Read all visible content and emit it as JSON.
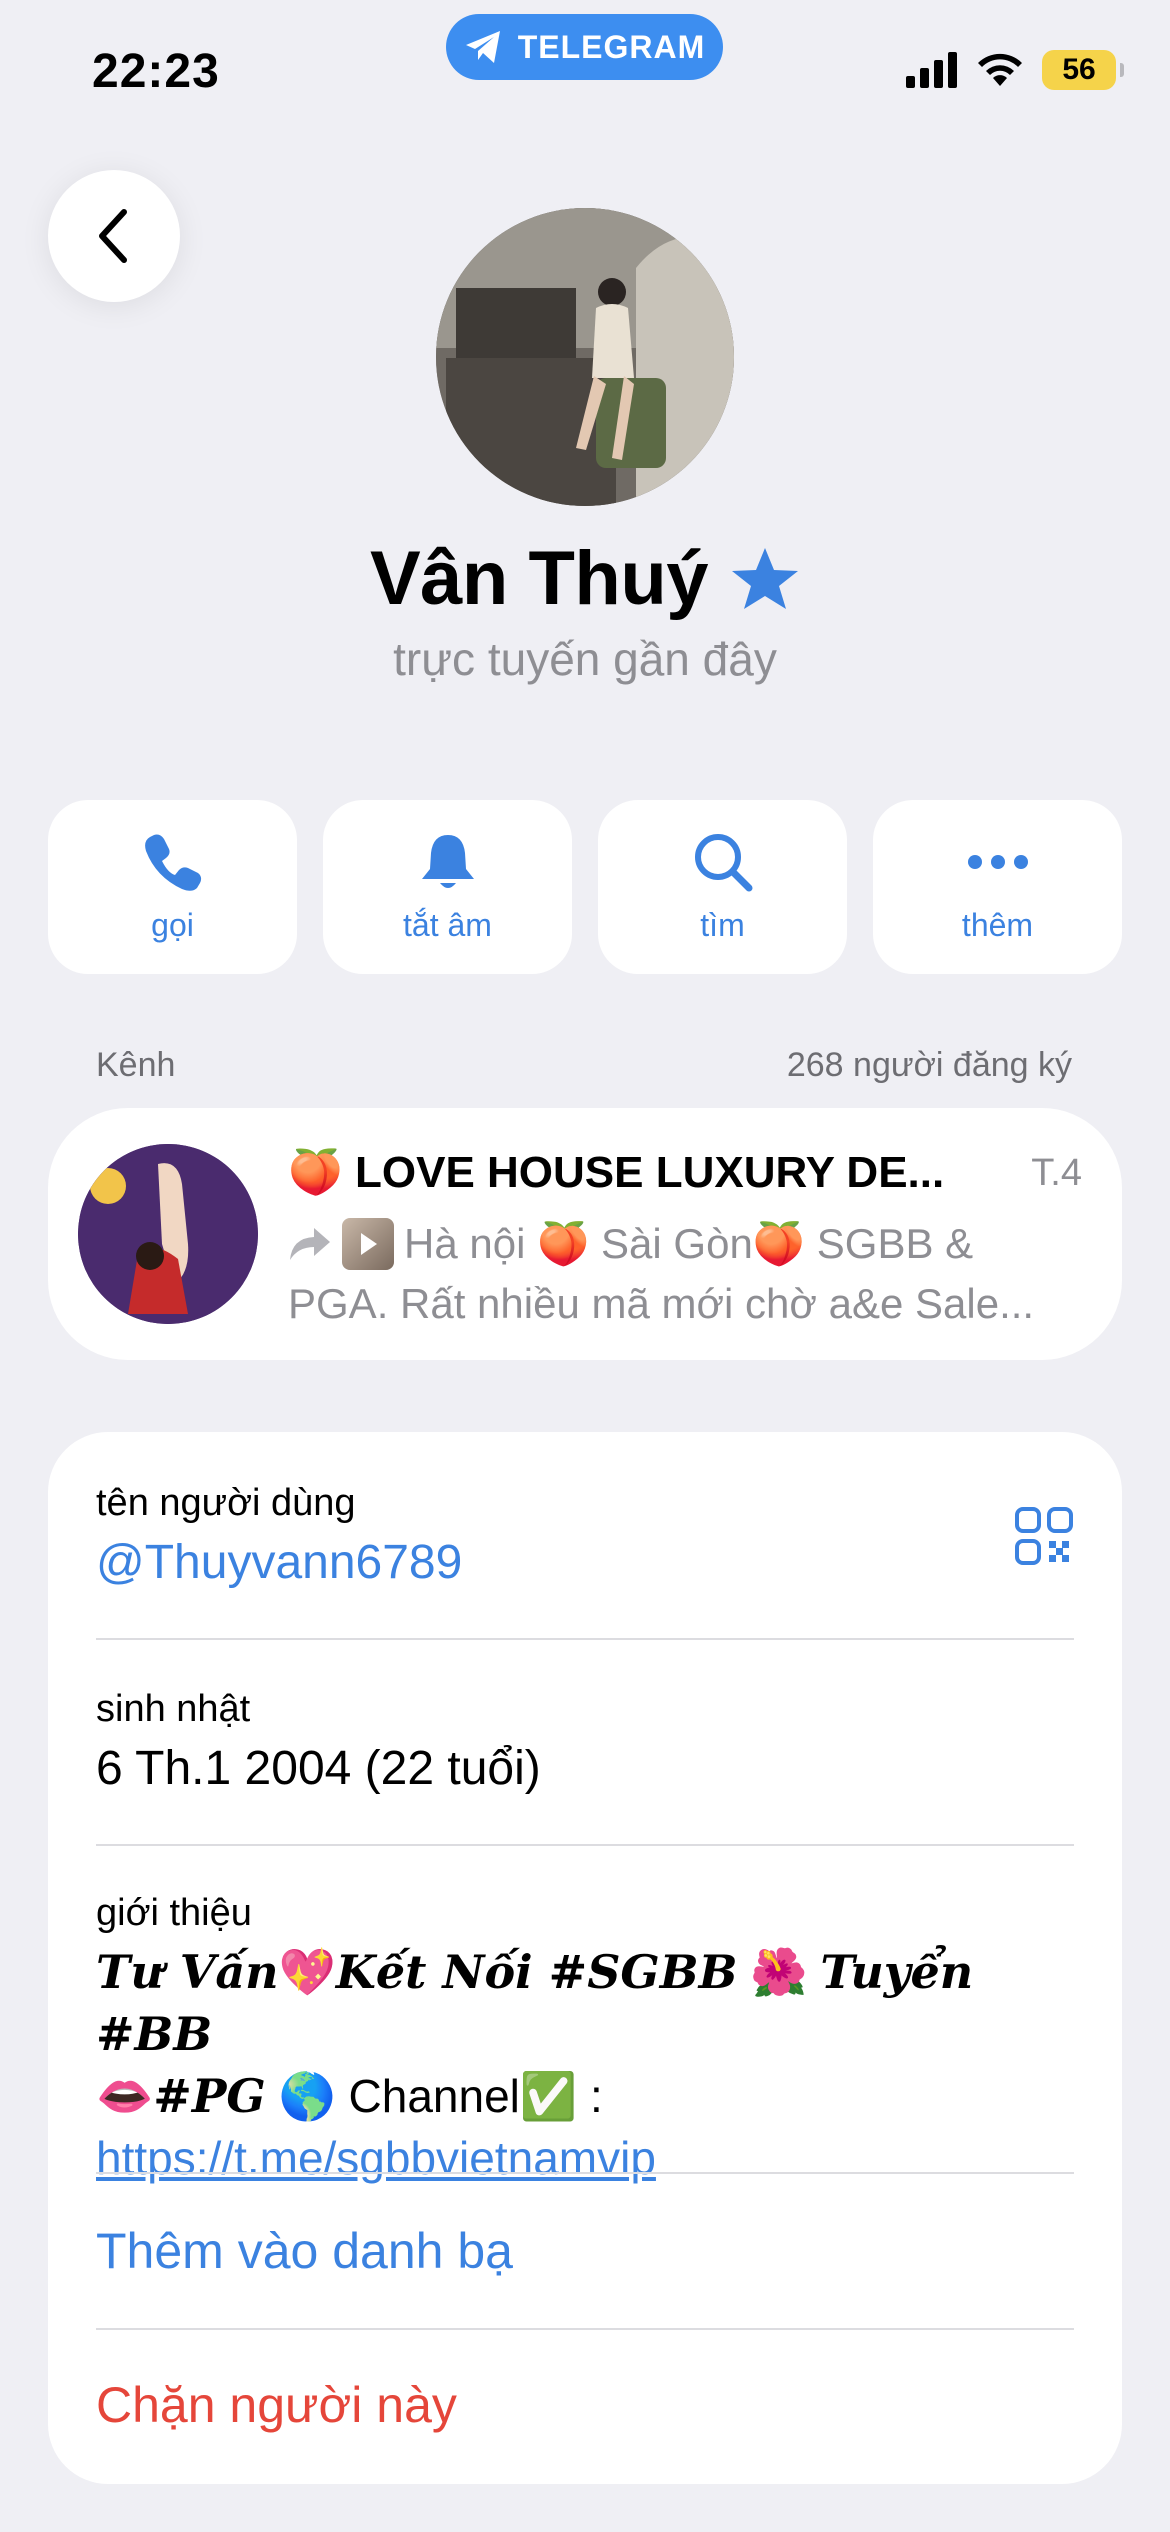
{
  "status_bar": {
    "time": "22:23",
    "app_badge": "TELEGRAM",
    "battery": "56"
  },
  "profile": {
    "name": "Vân Thuý",
    "presence": "trực tuyến gần đây"
  },
  "actions": [
    {
      "label": "gọi",
      "icon": "phone-icon"
    },
    {
      "label": "tắt âm",
      "icon": "bell-icon"
    },
    {
      "label": "tìm",
      "icon": "search-icon"
    },
    {
      "label": "thêm",
      "icon": "more-icon"
    }
  ],
  "channel": {
    "section_label": "Kênh",
    "subscribers": "268 người đăng ký",
    "title": "🍑 LOVE HOUSE LUXURY DE...",
    "date": "T.4",
    "preview_line1": "Hà nội 🍑 Sài Gòn🍑 SGBB &",
    "preview_line2": "PGA. Rất nhiều mã mới chờ a&e Sale..."
  },
  "info": {
    "username_label": "tên người dùng",
    "username_value": "@Thuyvann6789",
    "birthday_label": "sinh nhật",
    "birthday_value": "6 Th.1 2004 (22 tuổi)",
    "bio_label": "giới thiệu",
    "bio_part1": "Tư Vấn",
    "bio_emoji1": "💖",
    "bio_part2": "Kết Nối #SGBB",
    "bio_emoji2": "🌺",
    "bio_part3": "Tuyển #BB",
    "bio_emoji3": "👄",
    "bio_part4": "#PG",
    "bio_emoji4": "🌎",
    "bio_part5": "Channel✅ :",
    "bio_link": "https://t.me/sgbbvietnamvip",
    "add_contact": "Thêm vào danh bạ",
    "block_user": "Chặn người này"
  },
  "colors": {
    "accent": "#3b82e0",
    "danger": "#e5463a",
    "background": "#efeff4"
  }
}
